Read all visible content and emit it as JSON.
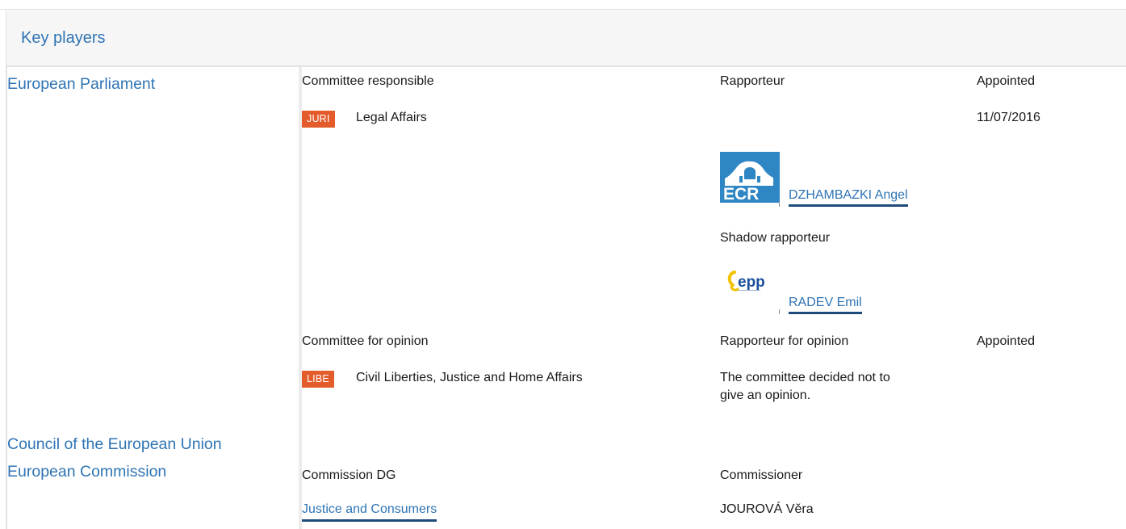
{
  "header": {
    "title": "Key players"
  },
  "institutions": {
    "parliament": "European Parliament",
    "council": "Council of the European Union",
    "commission": "European Commission"
  },
  "parliament": {
    "committee_responsible_label": "Committee responsible",
    "rapporteur_label": "Rapporteur",
    "appointed_label": "Appointed",
    "responsible_committee": {
      "code": "JURI",
      "name": "Legal Affairs",
      "appointed": "11/07/2016"
    },
    "rapporteur": {
      "group_logo": "ECR",
      "name": "DZHAMBAZKI Angel"
    },
    "shadow_rapporteur_label": "Shadow rapporteur",
    "shadow_rapporteur": {
      "group_logo": "epp",
      "name": "RADEV Emil"
    },
    "committee_opinion_label": "Committee for opinion",
    "rapporteur_opinion_label": "Rapporteur for opinion",
    "appointed_opinion_label": "Appointed",
    "opinion_committee": {
      "code": "LIBE",
      "name": "Civil Liberties, Justice and Home Affairs",
      "note_line1": "The committee decided not to",
      "note_line2": "give an opinion."
    }
  },
  "commission": {
    "dg_label": "Commission DG",
    "commissioner_label": "Commissioner",
    "dg_name": "Justice and Consumers",
    "commissioner_name": "JOUROVÁ Věra"
  },
  "colors": {
    "link": "#2f74b4",
    "badge": "#e45c2c",
    "underline": "#1e4b7a",
    "ecr_blue": "#2f86c4"
  }
}
